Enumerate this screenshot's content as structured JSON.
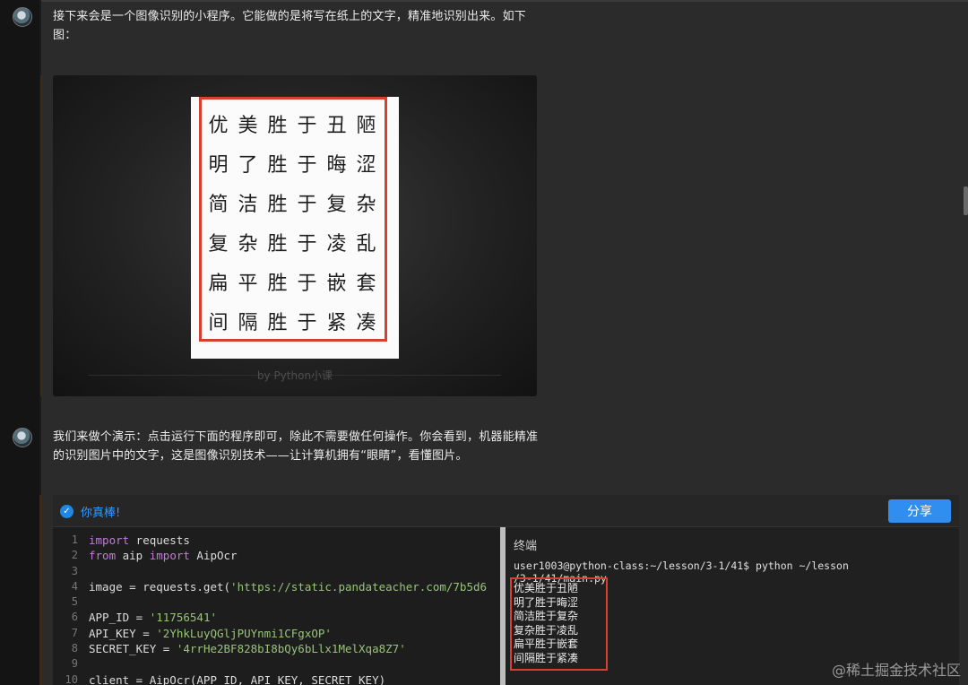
{
  "messages": [
    {
      "text": "接下来会是一个图像识别的小程序。它能做的是将写在纸上的文字，精准地识别出来。如下图："
    },
    {
      "text": "我们来做个演示：点击运行下面的程序即可，除此不需要做任何操作。你会看到，机器能精准的识别图片中的文字，这是图像识别技术——让计算机拥有“眼睛”，看懂图片。"
    }
  ],
  "image": {
    "characters": [
      "优",
      "美",
      "胜",
      "于",
      "丑",
      "陋",
      "明",
      "了",
      "胜",
      "于",
      "晦",
      "涩",
      "简",
      "洁",
      "胜",
      "于",
      "复",
      "杂",
      "复",
      "杂",
      "胜",
      "于",
      "凌",
      "乱",
      "扁",
      "平",
      "胜",
      "于",
      "嵌",
      "套",
      "间",
      "隔",
      "胜",
      "于",
      "紧",
      "凑"
    ],
    "byline": "by Python小课"
  },
  "ide": {
    "status_text": "你真棒!",
    "share_label": "分享",
    "line_numbers": [
      "1",
      "2",
      "3",
      "4",
      "5",
      "6",
      "7",
      "8",
      "9",
      "10"
    ],
    "code": {
      "l1_kw": "import",
      "l1_rest": " requests",
      "l2_kw1": "from",
      "l2_mid": " aip ",
      "l2_kw2": "import",
      "l2_rest": " AipOcr",
      "l4_pre": "image = requests.get(",
      "l4_str": "'https://static.pandateacher.com/7b5d6",
      "l6_pre": "APP_ID = ",
      "l6_str": "'11756541'",
      "l7_pre": "API_KEY = ",
      "l7_str": "'2YhkLuyQGljPUYnmi1CFgxOP'",
      "l8_pre": "SECRET_KEY = ",
      "l8_str": "'4rrHe2BF828bI8bQy6bLlx1MelXqa8Z7'",
      "l10": "client = AipOcr(APP_ID, API_KEY, SECRET_KEY)"
    },
    "terminal": {
      "title": "终端",
      "prompt": "user1003@python-class:~/lesson/3-1/41$ python ~/lesson\n/3-1/41/main.py",
      "output": [
        "优美胜于丑陋",
        "明了胜于晦涩",
        "简洁胜于复杂",
        "复杂胜于凌乱",
        "扁平胜于嵌套",
        "间隔胜于紧凑"
      ]
    }
  },
  "site_mark": "@稀土掘金技术社区",
  "colors": {
    "accent_blue": "#2f8ef0",
    "highlight_red": "#d7402f",
    "keyword": "#c678dd",
    "string": "#98c379"
  }
}
